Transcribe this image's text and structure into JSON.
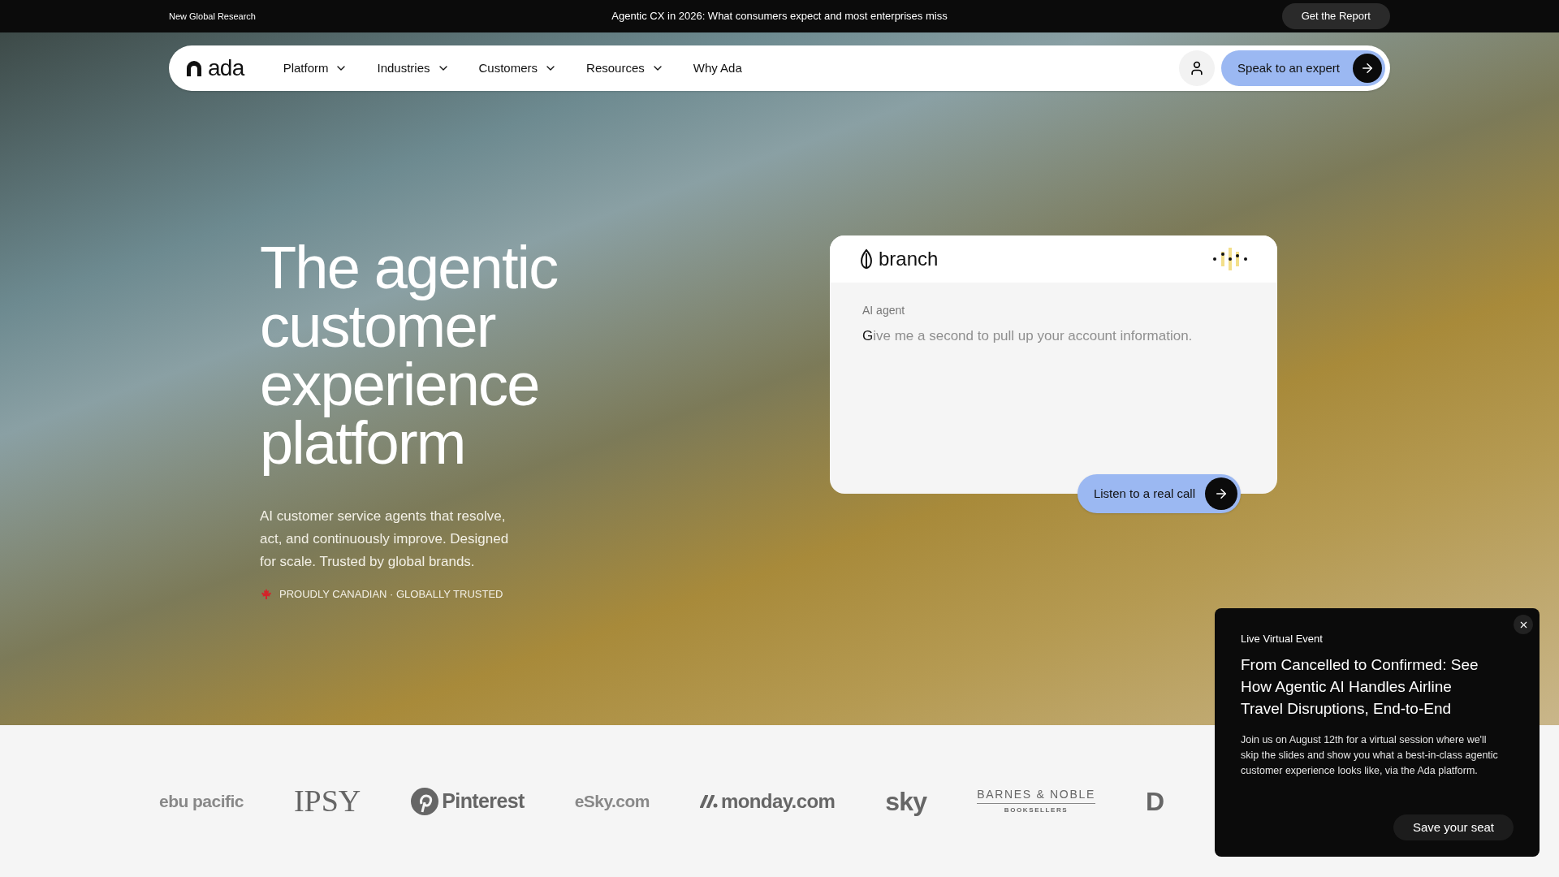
{
  "announcement": {
    "label": "New Global Research",
    "headline": "Agentic CX in 2026: What consumers expect and most enterprises miss",
    "button": "Get the Report"
  },
  "nav": {
    "logo": "ada",
    "items": [
      {
        "label": "Platform",
        "dropdown": true
      },
      {
        "label": "Industries",
        "dropdown": true
      },
      {
        "label": "Customers",
        "dropdown": true
      },
      {
        "label": "Resources",
        "dropdown": true
      },
      {
        "label": "Why Ada",
        "dropdown": false
      }
    ],
    "cta": "Speak to an expert"
  },
  "hero": {
    "title": "The agentic customer experience platform",
    "subtitle": "AI customer service agents that resolve, act, and continuously improve. Designed for scale. Trusted by global brands.",
    "tagline": "PROUDLY CANADIAN · GLOBALLY TRUSTED"
  },
  "demo_card": {
    "brand": "branch",
    "speaker": "AI agent",
    "transcript": {
      "typed": "G",
      "pending": "ive me a second to pull up your account information."
    },
    "button": "Listen to a real call"
  },
  "popup": {
    "eyebrow": "Live Virtual Event",
    "title": "From Cancelled to Confirmed: See How Agentic AI Handles Airline Travel Disruptions, End-to-End",
    "body": "Join us on August 12th for a virtual session where we'll skip the slides and show you what a best-in-class agentic customer experience looks like, via the Ada platform.",
    "button": "Save your seat"
  },
  "logos": [
    {
      "text": "ebu pacific",
      "kind": "plain"
    },
    {
      "text": "IPSY",
      "kind": "serif"
    },
    {
      "text": "Pinterest",
      "kind": "pin"
    },
    {
      "text": "eSky.com",
      "kind": "plain"
    },
    {
      "text": "monday.com",
      "kind": "mark"
    },
    {
      "text": "sky",
      "kind": "bold"
    },
    {
      "text": "BARNES & NOBLE",
      "sub": "BOOKSELLERS",
      "kind": "stacked"
    },
    {
      "text": "D",
      "kind": "bold"
    }
  ]
}
